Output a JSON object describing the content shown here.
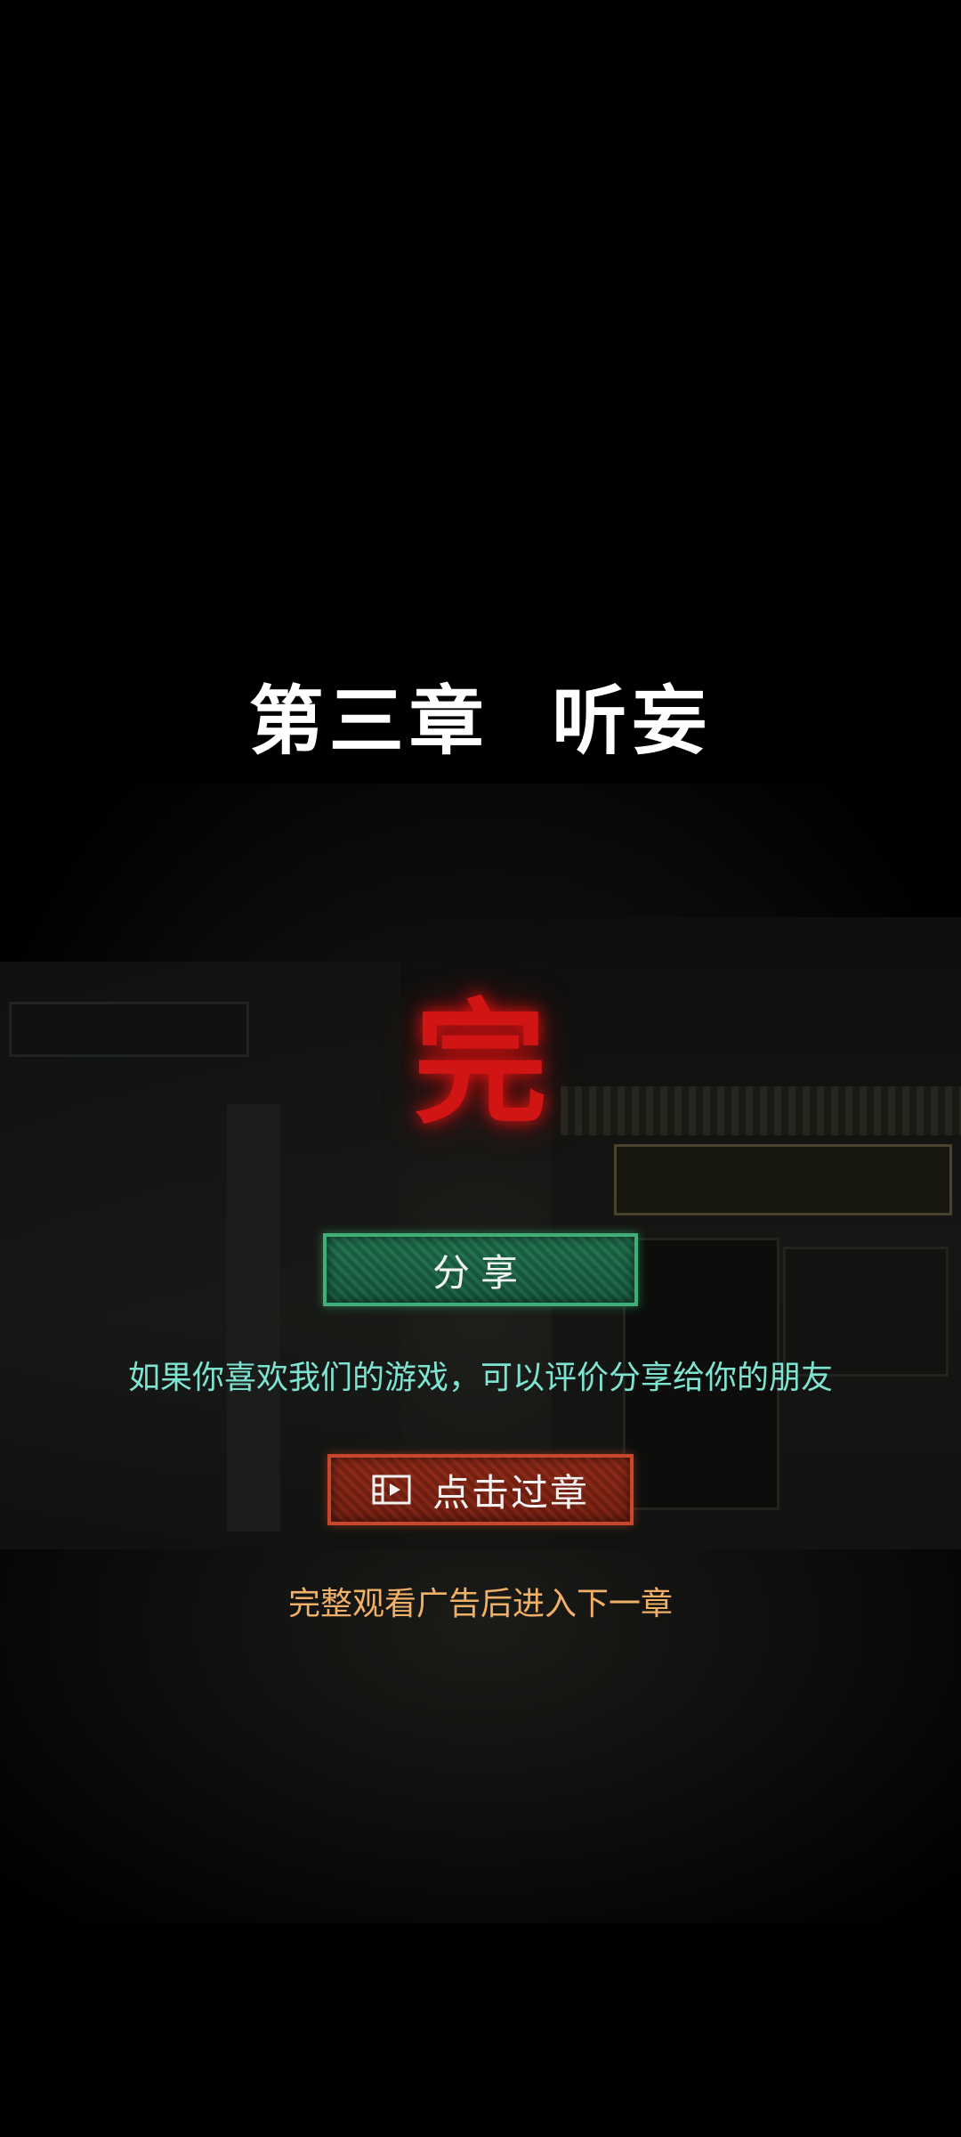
{
  "chapter": {
    "title": "第三章  听妄"
  },
  "end_mark": "完",
  "share": {
    "label": "分享",
    "hint": "如果你喜欢我们的游戏，可以评价分享给你的朋友"
  },
  "skip": {
    "label": "点击过章",
    "icon": "video-ad-icon",
    "hint": "完整观看广告后进入下一章"
  },
  "colors": {
    "end_mark": "#d11515",
    "share_hint": "#7fe3d2",
    "skip_hint": "#f0b067",
    "share_button": "#1f6b4b",
    "skip_button": "#8a2a18"
  }
}
